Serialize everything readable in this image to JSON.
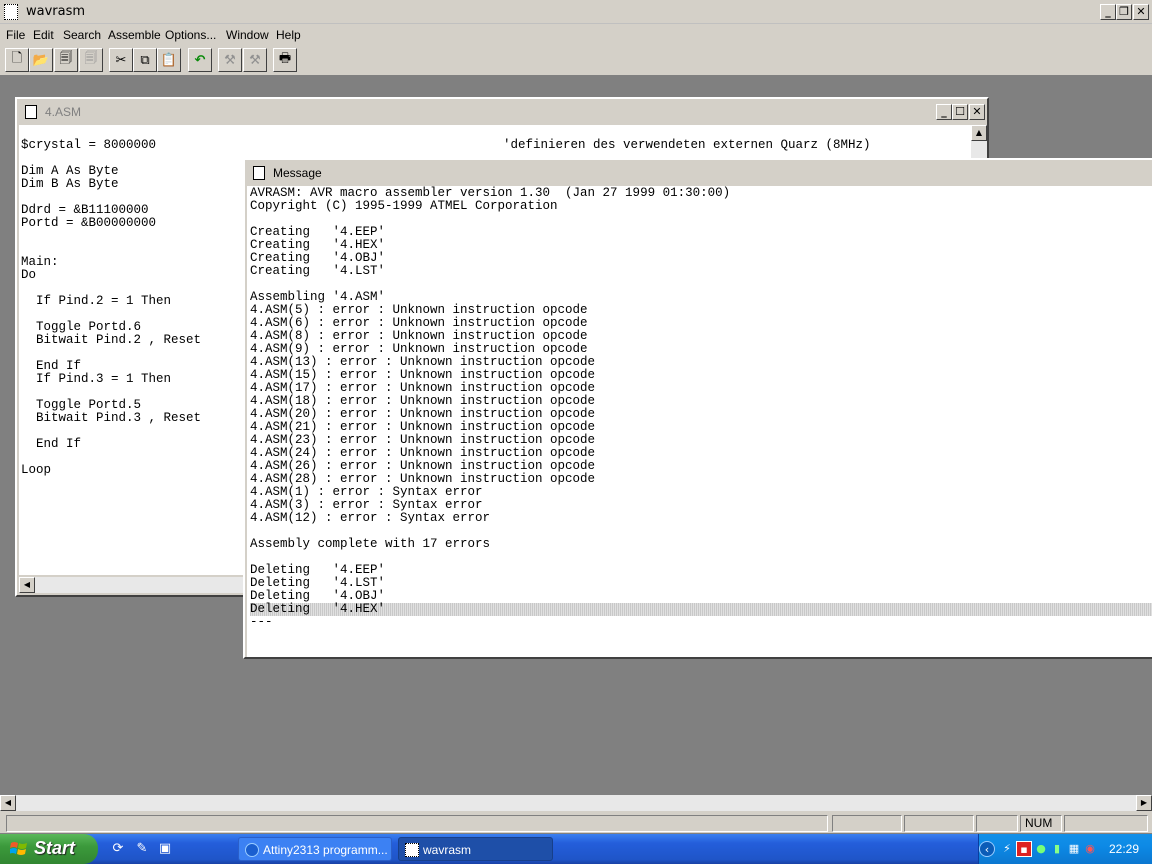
{
  "app": {
    "title": "wavrasm",
    "caption_buttons": {
      "minimize": "_",
      "restore": "❐",
      "close": "✕"
    }
  },
  "menu": [
    "File",
    "Edit",
    "Search",
    "Assemble",
    "Options...",
    "Window",
    "Help"
  ],
  "toolbar": {
    "buttons": [
      {
        "name": "new-icon",
        "glyph": "🗋",
        "enabled": true
      },
      {
        "name": "open-icon",
        "glyph": "📂",
        "enabled": true
      },
      {
        "name": "save-icon",
        "glyph": "🗐",
        "enabled": true
      },
      {
        "name": "save-all-icon",
        "glyph": "🗐",
        "enabled": false
      },
      {
        "name": "cut-icon",
        "glyph": "✂",
        "enabled": true
      },
      {
        "name": "copy-icon",
        "glyph": "⧉",
        "enabled": true
      },
      {
        "name": "paste-icon",
        "glyph": "📋",
        "enabled": true
      },
      {
        "name": "undo-icon",
        "glyph": "↶",
        "enabled": true
      },
      {
        "name": "assemble-icon",
        "glyph": "⚒",
        "enabled": false
      },
      {
        "name": "assemble-all-icon",
        "glyph": "⚒",
        "enabled": false
      },
      {
        "name": "print-icon",
        "glyph": "🖶",
        "enabled": true
      }
    ]
  },
  "editor": {
    "title": "4.ASM",
    "code": "$crystal = 8000000\n\nDim A As Byte\nDim B As Byte\n\nDdrd = &B11100000\nPortd = &B00000000\n\n\nMain:\nDo\n\n  If Pind.2 = 1 Then\n\n  Toggle Portd.6\n  Bitwait Pind.2 , Reset\n\n  End If\n  If Pind.3 = 1 Then\n\n  Toggle Portd.5\n  Bitwait Pind.3 , Reset\n\n  End If\n\nLoop",
    "comment": "'definieren des verwendeten externen Quarz (8MHz)"
  },
  "message_window": {
    "title": "Message",
    "lines": [
      "AVRASM: AVR macro assembler version 1.30  (Jan 27 1999 01:30:00)",
      "Copyright (C) 1995-1999 ATMEL Corporation",
      "",
      "Creating   '4.EEP'",
      "Creating   '4.HEX'",
      "Creating   '4.OBJ'",
      "Creating   '4.LST'",
      "",
      "Assembling '4.ASM'",
      "4.ASM(5) : error : Unknown instruction opcode",
      "4.ASM(6) : error : Unknown instruction opcode",
      "4.ASM(8) : error : Unknown instruction opcode",
      "4.ASM(9) : error : Unknown instruction opcode",
      "4.ASM(13) : error : Unknown instruction opcode",
      "4.ASM(15) : error : Unknown instruction opcode",
      "4.ASM(17) : error : Unknown instruction opcode",
      "4.ASM(18) : error : Unknown instruction opcode",
      "4.ASM(20) : error : Unknown instruction opcode",
      "4.ASM(21) : error : Unknown instruction opcode",
      "4.ASM(23) : error : Unknown instruction opcode",
      "4.ASM(24) : error : Unknown instruction opcode",
      "4.ASM(26) : error : Unknown instruction opcode",
      "4.ASM(28) : error : Unknown instruction opcode",
      "4.ASM(1) : error : Syntax error",
      "4.ASM(3) : error : Syntax error",
      "4.ASM(12) : error : Syntax error",
      "",
      "Assembly complete with 17 errors",
      "",
      "Deleting   '4.EEP'",
      "Deleting   '4.LST'",
      "Deleting   '4.OBJ'",
      "Deleting   '4.HEX'",
      "---"
    ],
    "selected_index": 32
  },
  "statusbar": {
    "num_lock": "NUM"
  },
  "taskbar": {
    "start_label": "Start",
    "tasks": [
      {
        "label": "Attiny2313 programm...",
        "active": false
      },
      {
        "label": "wavrasm",
        "active": true
      }
    ],
    "clock": "22:29"
  },
  "colors": {
    "taskbar_blue": "#245edb",
    "start_green": "#3c9a3c",
    "face": "#d4d0c8"
  }
}
